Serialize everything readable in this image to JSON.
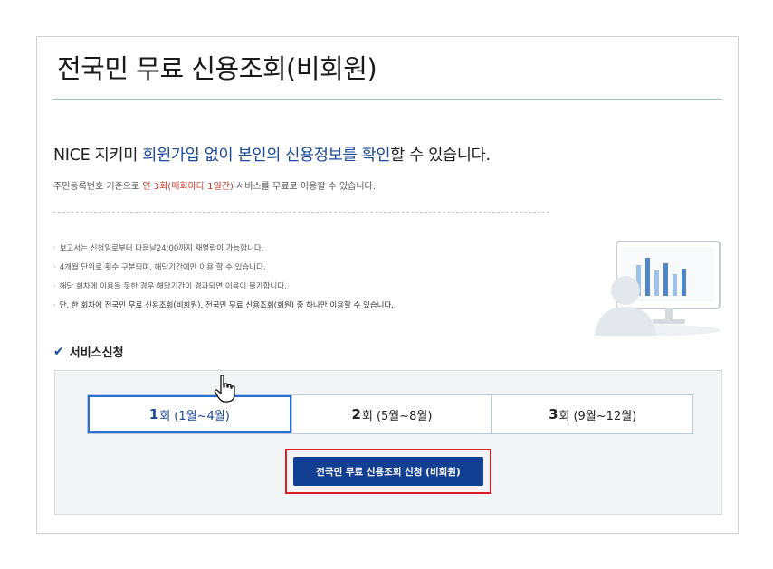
{
  "page": {
    "title": "전국민 무료 신용조회(비회원)",
    "headline": {
      "prefix": "NICE 지키미 ",
      "hl1": "회원가입 없이",
      "mid": " ",
      "hl2": "본인의 신용정보를 확인",
      "suffix": "할 수 있습니다."
    },
    "sub": {
      "prefix": "주민등록번호 기준으로 ",
      "highlight": "연 3회(매회마다 1일간)",
      "suffix": " 서비스를 무료로 이용할 수 있습니다."
    },
    "notes": [
      "보고서는 신청일로부터 다음날24:00까지 재열람이 가능합니다.",
      "4개월 단위로 횟수 구분되며, 해당기간에만 이용 할 수 있습니다.",
      "해당 회차에 이용을 못한 경우 해당기간이 경과되면 이용이 불가합니다.",
      "단, 한 회차에 전국민 무료 신용조회(비회원), 전국민 무료 신용조회(회원) 중 하나만 이용할 수 있습니다."
    ]
  },
  "service": {
    "label": "서비스신청",
    "tabs": [
      {
        "num": "1",
        "unit": "회",
        "range": "(1월~4월)"
      },
      {
        "num": "2",
        "unit": "회",
        "range": "(5월~8월)"
      },
      {
        "num": "3",
        "unit": "회",
        "range": "(9월~12월)"
      }
    ],
    "active_tab": 1,
    "cta": "전국민 무료 신용조회 신청 (비회원)"
  },
  "icons": {
    "check": "check-icon",
    "cursor": "hand-pointer-icon",
    "illustration": "monitor-bar-chart-illustration"
  },
  "colors": {
    "accent": "#1a4a9a",
    "cta": "#133f92",
    "highlight_frame": "#d81e28",
    "red_text": "#c0392b"
  }
}
